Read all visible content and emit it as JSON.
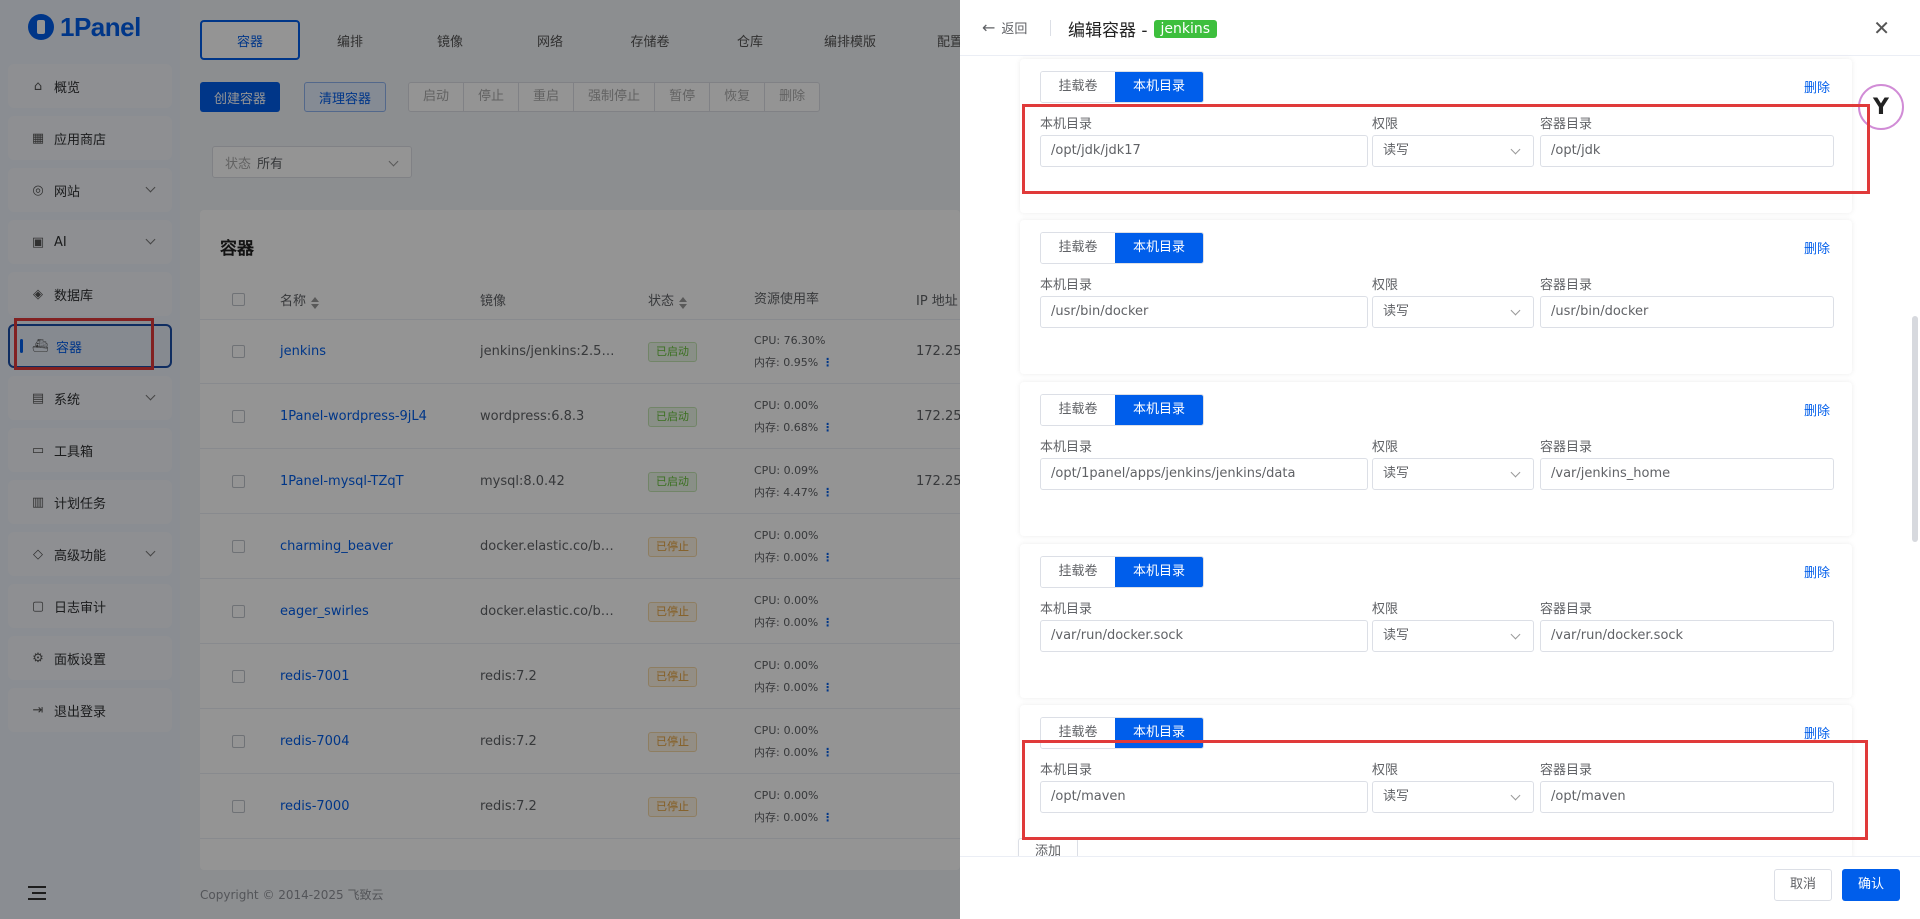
{
  "app": {
    "logo_text": "1Panel"
  },
  "sidebar": {
    "items": [
      {
        "label": "概览",
        "icon": "home-icon",
        "chevron": false
      },
      {
        "label": "应用商店",
        "icon": "grid-icon",
        "chevron": false
      },
      {
        "label": "网站",
        "icon": "globe-icon",
        "chevron": true
      },
      {
        "label": "AI",
        "icon": "robot-icon",
        "chevron": true
      },
      {
        "label": "数据库",
        "icon": "layers-icon",
        "chevron": false
      },
      {
        "label": "容器",
        "icon": "docker-icon",
        "chevron": false,
        "active": true
      },
      {
        "label": "系统",
        "icon": "server-icon",
        "chevron": true
      },
      {
        "label": "工具箱",
        "icon": "toolbox-icon",
        "chevron": false
      },
      {
        "label": "计划任务",
        "icon": "calendar-icon",
        "chevron": false
      },
      {
        "label": "高级功能",
        "icon": "diamond-icon",
        "chevron": true
      },
      {
        "label": "日志审计",
        "icon": "log-icon",
        "chevron": false
      },
      {
        "label": "面板设置",
        "icon": "gear-icon",
        "chevron": false
      },
      {
        "label": "退出登录",
        "icon": "logout-icon",
        "chevron": false
      }
    ]
  },
  "tabs": [
    "容器",
    "编排",
    "镜像",
    "网络",
    "存储卷",
    "仓库",
    "编排模版",
    "配置"
  ],
  "toolbar": {
    "create": "创建容器",
    "clean": "清理容器",
    "actions": [
      "启动",
      "停止",
      "重启",
      "强制停止",
      "暂停",
      "恢复",
      "删除"
    ]
  },
  "filter": {
    "label": "状态",
    "value": "所有"
  },
  "table": {
    "title": "容器",
    "columns": [
      "名称",
      "镜像",
      "状态",
      "资源使用率",
      "IP 地址"
    ],
    "rows": [
      {
        "name": "jenkins",
        "image": "jenkins/jenkins:2.52...",
        "state": "已启动",
        "running": true,
        "cpu": "CPU: 76.30%",
        "mem": "内存: 0.95%",
        "ip": "172.25"
      },
      {
        "name": "1Panel-wordpress-9jL4",
        "image": "wordpress:6.8.3",
        "state": "已启动",
        "running": true,
        "cpu": "CPU: 0.00%",
        "mem": "内存: 0.68%",
        "ip": "172.25"
      },
      {
        "name": "1Panel-mysql-TZqT",
        "image": "mysql:8.0.42",
        "state": "已启动",
        "running": true,
        "cpu": "CPU: 0.09%",
        "mem": "内存: 4.47%",
        "ip": "172.25"
      },
      {
        "name": "charming_beaver",
        "image": "docker.elastic.co/be...",
        "state": "已停止",
        "running": false,
        "cpu": "CPU: 0.00%",
        "mem": "内存: 0.00%",
        "ip": ""
      },
      {
        "name": "eager_swirles",
        "image": "docker.elastic.co/be...",
        "state": "已停止",
        "running": false,
        "cpu": "CPU: 0.00%",
        "mem": "内存: 0.00%",
        "ip": ""
      },
      {
        "name": "redis-7001",
        "image": "redis:7.2",
        "state": "已停止",
        "running": false,
        "cpu": "CPU: 0.00%",
        "mem": "内存: 0.00%",
        "ip": ""
      },
      {
        "name": "redis-7004",
        "image": "redis:7.2",
        "state": "已停止",
        "running": false,
        "cpu": "CPU: 0.00%",
        "mem": "内存: 0.00%",
        "ip": ""
      },
      {
        "name": "redis-7000",
        "image": "redis:7.2",
        "state": "已停止",
        "running": false,
        "cpu": "CPU: 0.00%",
        "mem": "内存: 0.00%",
        "ip": ""
      }
    ]
  },
  "footer": {
    "copyright": "Copyright © 2014-2025 飞致云"
  },
  "drawer": {
    "back": "返回",
    "title": "编辑容器 -",
    "container_name": "jenkins",
    "mount_type_options": [
      "挂载卷",
      "本机目录"
    ],
    "delete_label": "删除",
    "field_labels": {
      "host": "本机目录",
      "perm": "权限",
      "container": "容器目录"
    },
    "mounts": [
      {
        "host": "/opt/jdk/jdk17",
        "perm": "读写",
        "container": "/opt/jdk"
      },
      {
        "host": "/usr/bin/docker",
        "perm": "读写",
        "container": "/usr/bin/docker"
      },
      {
        "host": "/opt/1panel/apps/jenkins/jenkins/data",
        "perm": "读写",
        "container": "/var/jenkins_home"
      },
      {
        "host": "/var/run/docker.sock",
        "perm": "读写",
        "container": "/var/run/docker.sock"
      },
      {
        "host": "/opt/maven",
        "perm": "读写",
        "container": "/opt/maven"
      }
    ],
    "add": "添加",
    "cancel": "取消",
    "confirm": "确认"
  },
  "colors": {
    "primary": "#005eeb",
    "highlight": "#e03a3a",
    "running": "#67c23a",
    "stopped": "#e6a23c",
    "tag": "#3dbf3d"
  }
}
